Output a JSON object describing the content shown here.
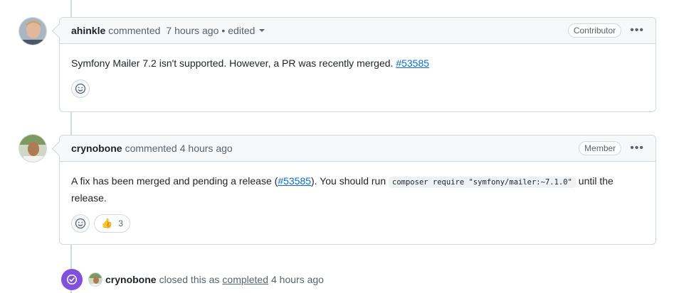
{
  "comments": [
    {
      "author": "ahinkle",
      "action": "commented",
      "time": "7 hours ago",
      "edited": "edited",
      "role": "Contributor",
      "body_text": "Symfony Mailer 7.2 isn't supported. However, a PR was recently merged.",
      "link": "#53585"
    },
    {
      "author": "crynobone",
      "action": "commented",
      "time": "4 hours ago",
      "role": "Member",
      "body_pre": "A fix has been merged and pending a release (",
      "link": "#53585",
      "body_mid": "). You should run",
      "code": "composer require \"symfony/mailer:~7.1.0\"",
      "body_post": "until the release.",
      "reaction_emoji": "👍",
      "reaction_count": "3"
    }
  ],
  "event": {
    "author": "crynobone",
    "text_before": "closed this as",
    "status_link": "completed",
    "time": "4 hours ago"
  },
  "colors": {
    "link": "#0969da",
    "closed_purple": "#8250df",
    "border": "#d1d9e0",
    "header_bg": "#f6f8fa"
  },
  "icons": {
    "smiley": "smiley-icon",
    "kebab": "kebab-horizontal-icon",
    "closed": "check-circle-icon"
  }
}
